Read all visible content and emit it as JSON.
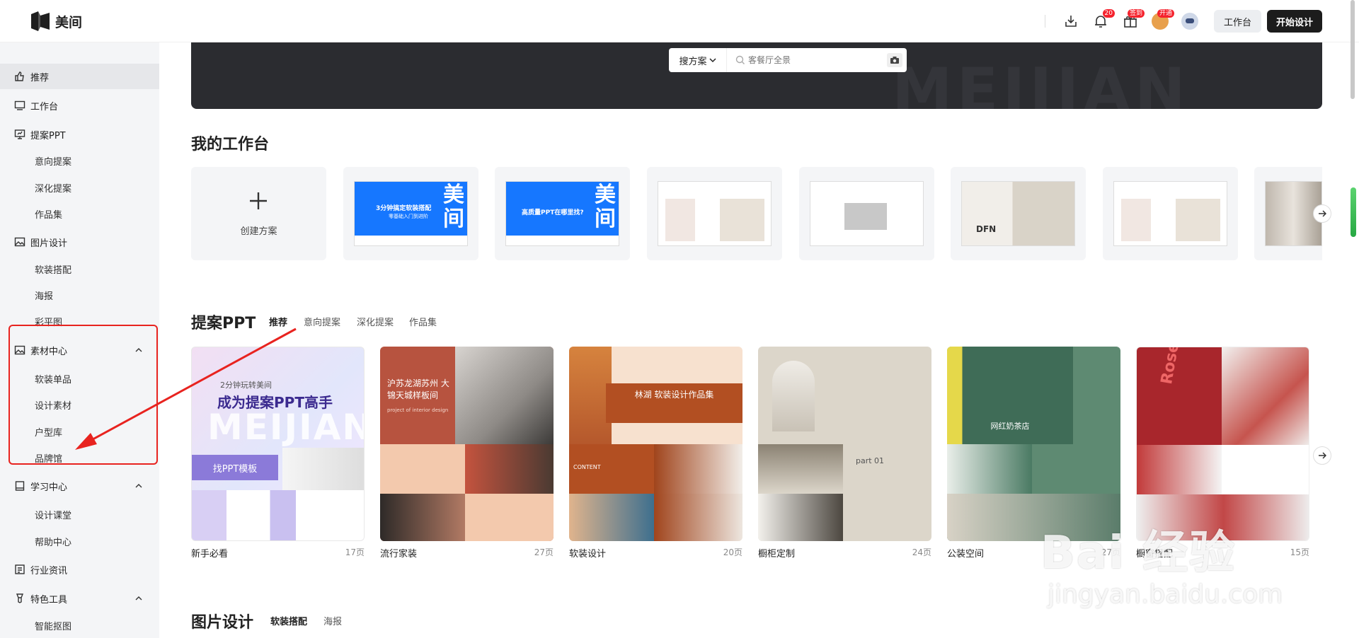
{
  "app": {
    "name": "美间"
  },
  "topbar": {
    "notification_badge": "20",
    "gift_badge": "签到",
    "vip_badge": "开通",
    "workbench_label": "工作台",
    "start_design_label": "开始设计"
  },
  "sidebar": {
    "items": [
      {
        "label": "推荐",
        "icon": "thumb-up-icon"
      },
      {
        "label": "工作台",
        "icon": "monitor-icon"
      },
      {
        "label": "提案PPT",
        "icon": "presentation-icon"
      },
      {
        "label": "图片设计",
        "icon": "image-icon"
      },
      {
        "label": "素材中心",
        "icon": "image-icon"
      },
      {
        "label": "学习中心",
        "icon": "book-icon"
      },
      {
        "label": "行业资讯",
        "icon": "news-icon"
      },
      {
        "label": "特色工具",
        "icon": "tool-icon"
      }
    ],
    "sub_ppt": [
      "意向提案",
      "深化提案",
      "作品集"
    ],
    "sub_image": [
      "软装搭配",
      "海报",
      "彩平图"
    ],
    "sub_material": [
      "软装单品",
      "设计素材",
      "户型库",
      "品牌馆"
    ],
    "sub_learn": [
      "设计课堂",
      "帮助中心"
    ],
    "sub_tools": [
      "智能抠图"
    ]
  },
  "search": {
    "type_label": "搜方案",
    "placeholder": "客餐厅全景"
  },
  "banner": {
    "watermark": "MEIJIAN"
  },
  "workbench": {
    "title": "我的工作台",
    "create_label": "创建方案",
    "thumbs": [
      {
        "line1": "3分钟搞定软装搭配",
        "line2": "零基础入门到进阶",
        "big": "美间"
      },
      {
        "line1": "高质量PPT在哪里找?",
        "big": "美间"
      }
    ]
  },
  "ppt_section": {
    "title": "提案PPT",
    "tabs": [
      "推荐",
      "意向提案",
      "深化提案",
      "作品集"
    ],
    "cards": [
      {
        "name": "新手必看",
        "count": "17页",
        "headline": "成为提案PPT高手",
        "sub": "2分钟玩转美间",
        "button": "找PPT模板",
        "big": "MEIJIAN"
      },
      {
        "name": "流行家装",
        "count": "27页",
        "headline": "沪苏龙湖苏州 大锦天城样板间",
        "sub": "project of interior design"
      },
      {
        "name": "软装设计",
        "count": "20页",
        "headline": "林湖 软装设计作品集",
        "sub": "CONTENT"
      },
      {
        "name": "橱柜定制",
        "count": "24页",
        "headline": "part 01"
      },
      {
        "name": "公装空间",
        "count": "27页",
        "headline": "网红奶茶店"
      },
      {
        "name": "橱窗搭配",
        "count": "15页",
        "headline": "Rosemary"
      }
    ]
  },
  "image_section": {
    "title": "图片设计",
    "tabs": [
      "软装搭配",
      "海报"
    ]
  },
  "watermark": {
    "text": "Bai 经验",
    "sub": "jingyan.baidu.com"
  }
}
